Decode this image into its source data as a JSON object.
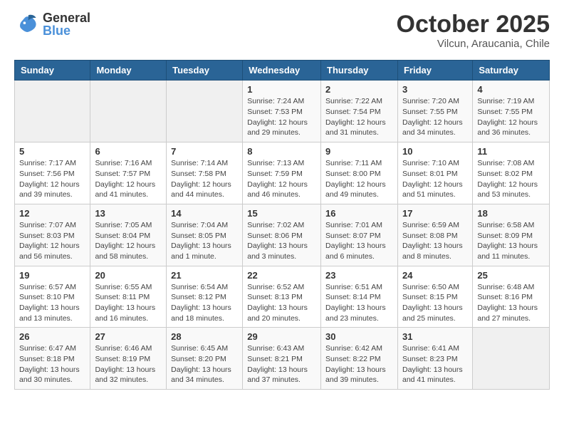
{
  "header": {
    "logo": {
      "general": "General",
      "blue": "Blue"
    },
    "title": "October 2025",
    "subtitle": "Vilcun, Araucania, Chile"
  },
  "calendar": {
    "headers": [
      "Sunday",
      "Monday",
      "Tuesday",
      "Wednesday",
      "Thursday",
      "Friday",
      "Saturday"
    ],
    "weeks": [
      {
        "days": [
          {
            "num": "",
            "info": ""
          },
          {
            "num": "",
            "info": ""
          },
          {
            "num": "",
            "info": ""
          },
          {
            "num": "1",
            "info": "Sunrise: 7:24 AM\nSunset: 7:53 PM\nDaylight: 12 hours\nand 29 minutes."
          },
          {
            "num": "2",
            "info": "Sunrise: 7:22 AM\nSunset: 7:54 PM\nDaylight: 12 hours\nand 31 minutes."
          },
          {
            "num": "3",
            "info": "Sunrise: 7:20 AM\nSunset: 7:55 PM\nDaylight: 12 hours\nand 34 minutes."
          },
          {
            "num": "4",
            "info": "Sunrise: 7:19 AM\nSunset: 7:55 PM\nDaylight: 12 hours\nand 36 minutes."
          }
        ]
      },
      {
        "days": [
          {
            "num": "5",
            "info": "Sunrise: 7:17 AM\nSunset: 7:56 PM\nDaylight: 12 hours\nand 39 minutes."
          },
          {
            "num": "6",
            "info": "Sunrise: 7:16 AM\nSunset: 7:57 PM\nDaylight: 12 hours\nand 41 minutes."
          },
          {
            "num": "7",
            "info": "Sunrise: 7:14 AM\nSunset: 7:58 PM\nDaylight: 12 hours\nand 44 minutes."
          },
          {
            "num": "8",
            "info": "Sunrise: 7:13 AM\nSunset: 7:59 PM\nDaylight: 12 hours\nand 46 minutes."
          },
          {
            "num": "9",
            "info": "Sunrise: 7:11 AM\nSunset: 8:00 PM\nDaylight: 12 hours\nand 49 minutes."
          },
          {
            "num": "10",
            "info": "Sunrise: 7:10 AM\nSunset: 8:01 PM\nDaylight: 12 hours\nand 51 minutes."
          },
          {
            "num": "11",
            "info": "Sunrise: 7:08 AM\nSunset: 8:02 PM\nDaylight: 12 hours\nand 53 minutes."
          }
        ]
      },
      {
        "days": [
          {
            "num": "12",
            "info": "Sunrise: 7:07 AM\nSunset: 8:03 PM\nDaylight: 12 hours\nand 56 minutes."
          },
          {
            "num": "13",
            "info": "Sunrise: 7:05 AM\nSunset: 8:04 PM\nDaylight: 12 hours\nand 58 minutes."
          },
          {
            "num": "14",
            "info": "Sunrise: 7:04 AM\nSunset: 8:05 PM\nDaylight: 13 hours\nand 1 minute."
          },
          {
            "num": "15",
            "info": "Sunrise: 7:02 AM\nSunset: 8:06 PM\nDaylight: 13 hours\nand 3 minutes."
          },
          {
            "num": "16",
            "info": "Sunrise: 7:01 AM\nSunset: 8:07 PM\nDaylight: 13 hours\nand 6 minutes."
          },
          {
            "num": "17",
            "info": "Sunrise: 6:59 AM\nSunset: 8:08 PM\nDaylight: 13 hours\nand 8 minutes."
          },
          {
            "num": "18",
            "info": "Sunrise: 6:58 AM\nSunset: 8:09 PM\nDaylight: 13 hours\nand 11 minutes."
          }
        ]
      },
      {
        "days": [
          {
            "num": "19",
            "info": "Sunrise: 6:57 AM\nSunset: 8:10 PM\nDaylight: 13 hours\nand 13 minutes."
          },
          {
            "num": "20",
            "info": "Sunrise: 6:55 AM\nSunset: 8:11 PM\nDaylight: 13 hours\nand 16 minutes."
          },
          {
            "num": "21",
            "info": "Sunrise: 6:54 AM\nSunset: 8:12 PM\nDaylight: 13 hours\nand 18 minutes."
          },
          {
            "num": "22",
            "info": "Sunrise: 6:52 AM\nSunset: 8:13 PM\nDaylight: 13 hours\nand 20 minutes."
          },
          {
            "num": "23",
            "info": "Sunrise: 6:51 AM\nSunset: 8:14 PM\nDaylight: 13 hours\nand 23 minutes."
          },
          {
            "num": "24",
            "info": "Sunrise: 6:50 AM\nSunset: 8:15 PM\nDaylight: 13 hours\nand 25 minutes."
          },
          {
            "num": "25",
            "info": "Sunrise: 6:48 AM\nSunset: 8:16 PM\nDaylight: 13 hours\nand 27 minutes."
          }
        ]
      },
      {
        "days": [
          {
            "num": "26",
            "info": "Sunrise: 6:47 AM\nSunset: 8:18 PM\nDaylight: 13 hours\nand 30 minutes."
          },
          {
            "num": "27",
            "info": "Sunrise: 6:46 AM\nSunset: 8:19 PM\nDaylight: 13 hours\nand 32 minutes."
          },
          {
            "num": "28",
            "info": "Sunrise: 6:45 AM\nSunset: 8:20 PM\nDaylight: 13 hours\nand 34 minutes."
          },
          {
            "num": "29",
            "info": "Sunrise: 6:43 AM\nSunset: 8:21 PM\nDaylight: 13 hours\nand 37 minutes."
          },
          {
            "num": "30",
            "info": "Sunrise: 6:42 AM\nSunset: 8:22 PM\nDaylight: 13 hours\nand 39 minutes."
          },
          {
            "num": "31",
            "info": "Sunrise: 6:41 AM\nSunset: 8:23 PM\nDaylight: 13 hours\nand 41 minutes."
          },
          {
            "num": "",
            "info": ""
          }
        ]
      }
    ]
  }
}
